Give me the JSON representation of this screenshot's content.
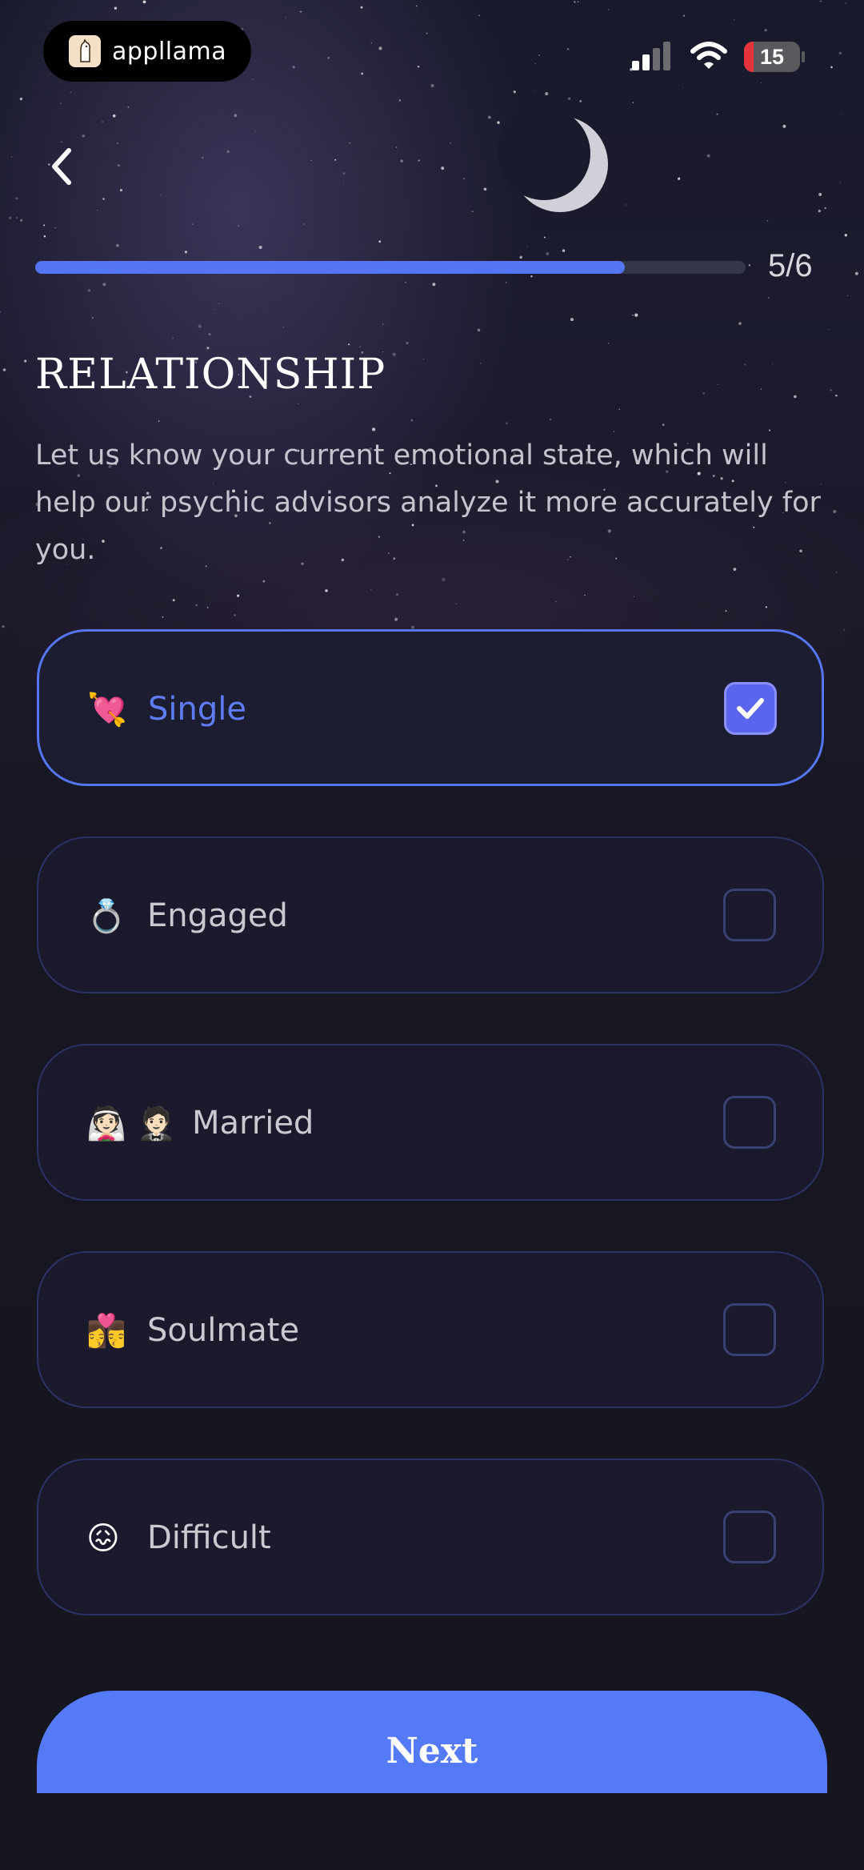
{
  "status_bar": {
    "app_name": "appllama",
    "battery": "15"
  },
  "progress": {
    "text": "5/6",
    "fraction": 0.83
  },
  "header": {
    "title": "RELATIONSHIP",
    "subtitle": "Let us know your current emotional state, which will help our psychic advisors analyze it more accurately for you."
  },
  "options": [
    {
      "emoji": "💘",
      "label": "Single",
      "selected": true
    },
    {
      "emoji": "💍",
      "label": "Engaged",
      "selected": false
    },
    {
      "emoji": "👰🏻 🤵🏻",
      "label": "Married",
      "selected": false
    },
    {
      "emoji": "👩‍❤️‍💋‍👨",
      "label": "Soulmate",
      "selected": false
    },
    {
      "emoji": "😖",
      "label": "Difficult",
      "selected": false
    }
  ],
  "next_button": {
    "label": "Next"
  },
  "colors": {
    "accent": "#547af8",
    "selected_text": "#5e7df5",
    "background": "#16161f"
  }
}
